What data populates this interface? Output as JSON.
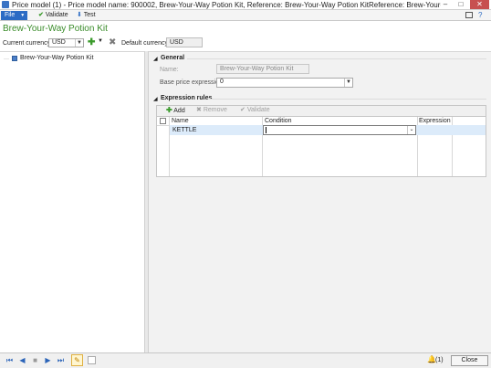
{
  "window": {
    "title": "Price model (1) - Price model name: 900002, Brew-Your-Way Potion Kit, Reference: Brew-Your-Way Potion KitReference: Brew-Your-Wa...",
    "minimize": "–",
    "maximize": "□",
    "close": "✕"
  },
  "ribbon": {
    "file_label": "File",
    "validate_label": "Validate",
    "test_label": "Test"
  },
  "header": {
    "title": "Brew-Your-Way Potion Kit",
    "current_currency_label": "Current currency:",
    "current_currency_value": "USD",
    "default_currency_label": "Default currency:",
    "default_currency_value": "USD"
  },
  "tree": {
    "root_label": "Brew-Your-Way Potion Kit"
  },
  "general": {
    "title": "General",
    "name_label": "Name:",
    "name_value": "Brew-Your-Way Potion Kit",
    "base_price_label": "Base price expression:",
    "base_price_value": "0"
  },
  "expression_rules": {
    "title": "Expression rules",
    "add_label": "Add",
    "remove_label": "Remove",
    "validate_label": "Validate",
    "columns": [
      "Name",
      "Condition",
      "Expression"
    ],
    "rows": [
      {
        "name": "KETTLE",
        "condition": "",
        "expression": ""
      }
    ]
  },
  "status": {
    "alerts": "(1)",
    "close_label": "Close"
  }
}
